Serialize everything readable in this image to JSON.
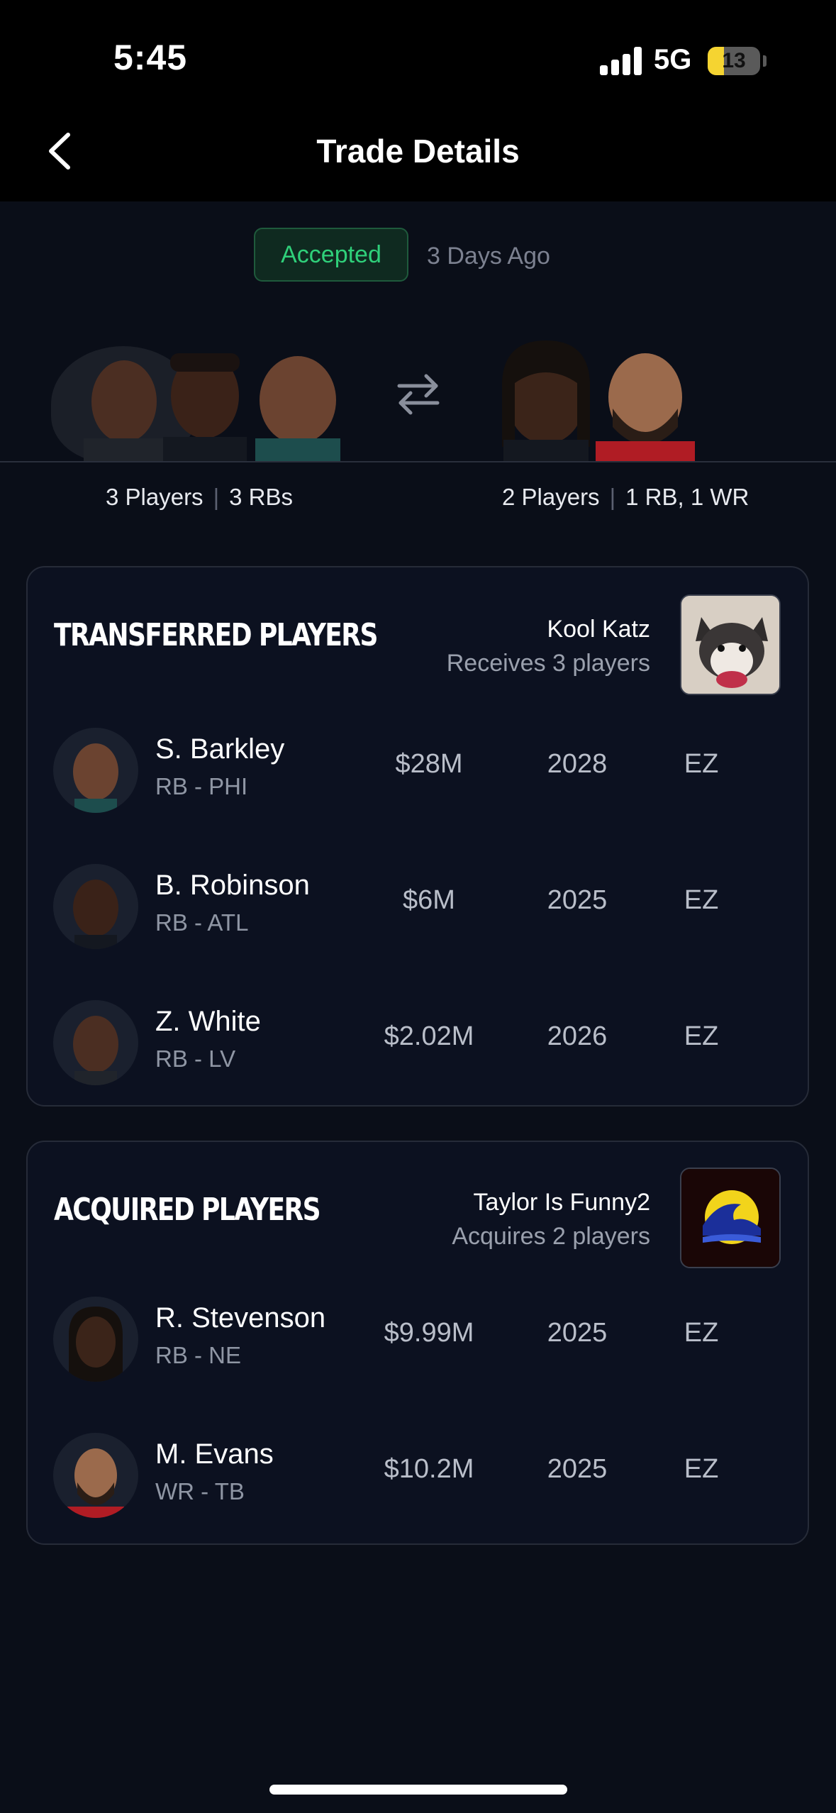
{
  "status_bar": {
    "time": "5:45",
    "network": "5G",
    "battery": "13",
    "battery_level": 0.13
  },
  "header": {
    "title": "Trade Details"
  },
  "trade": {
    "status": "Accepted",
    "time_ago": "3 Days Ago",
    "left_summary": {
      "count": "3 Players",
      "positions": "3 RBs"
    },
    "right_summary": {
      "count": "2 Players",
      "positions": "1 RB, 1 WR"
    }
  },
  "colors": {
    "accent_green": "#2fd07a",
    "background": "#0a0e18",
    "card": "#0c1120"
  },
  "icons": {
    "back": "chevron-left-icon",
    "swap": "swap-arrows-icon"
  },
  "transferred": {
    "title": "TRANSFERRED PLAYERS",
    "team_name": "Kool Katz",
    "team_sub": "Receives 3 players",
    "players": [
      {
        "name": "S. Barkley",
        "pos": "RB - PHI",
        "salary": "$28M",
        "year": "2028",
        "tag": "EZ"
      },
      {
        "name": "B. Robinson",
        "pos": "RB - ATL",
        "salary": "$6M",
        "year": "2025",
        "tag": "EZ"
      },
      {
        "name": "Z. White",
        "pos": "RB - LV",
        "salary": "$2.02M",
        "year": "2026",
        "tag": "EZ"
      }
    ]
  },
  "acquired": {
    "title": "ACQUIRED PLAYERS",
    "team_name": "Taylor Is Funny2",
    "team_sub": "Acquires 2 players",
    "players": [
      {
        "name": "R. Stevenson",
        "pos": "RB - NE",
        "salary": "$9.99M",
        "year": "2025",
        "tag": "EZ"
      },
      {
        "name": "M. Evans",
        "pos": "WR - TB",
        "salary": "$10.2M",
        "year": "2025",
        "tag": "EZ"
      }
    ]
  }
}
